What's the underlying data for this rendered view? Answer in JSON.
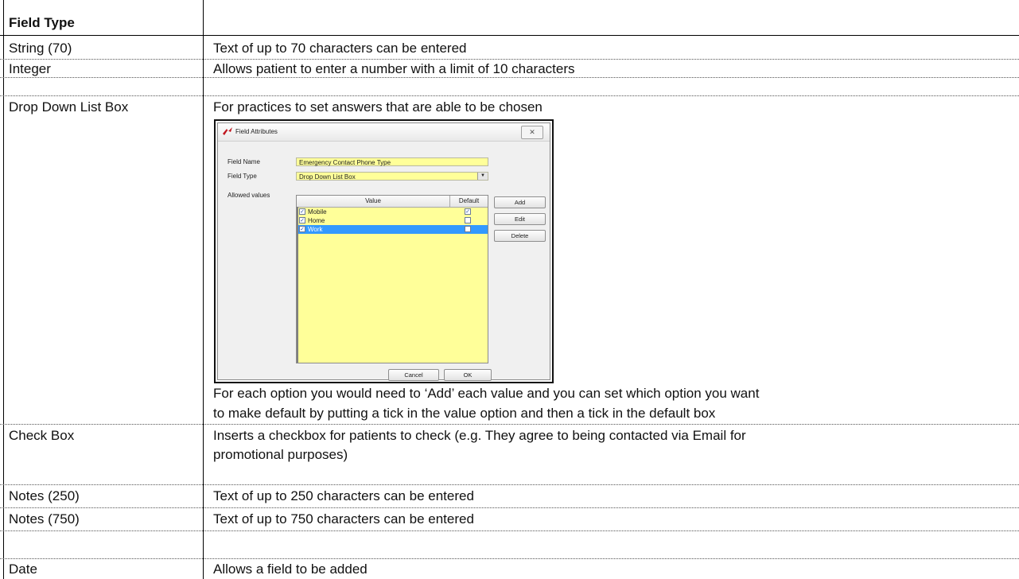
{
  "table": {
    "header": {
      "col1": "Field Type",
      "col2": ""
    },
    "rows": [
      {
        "type": "String (70)",
        "desc": "Text of up to 70 characters can be entered"
      },
      {
        "type": "Integer",
        "desc": "Allows patient to enter a number with a limit of 10 characters"
      },
      {
        "type": "Drop Down List Box",
        "desc": "For practices to set answers that are able to be chosen",
        "desc_after_line1": "For each option you would need to ‘Add’ each value and you can set which option you want",
        "desc_after_line2": "to make default by putting a tick in the value option and then a tick in the default box"
      },
      {
        "type": "Check Box",
        "desc_line1": "Inserts a checkbox for patients to check (e.g. They agree to being contacted via Email for",
        "desc_line2": "promotional purposes)"
      },
      {
        "type": "Notes (250)",
        "desc": "Text of up to 250 characters can be entered"
      },
      {
        "type": "Notes (750)",
        "desc": "Text of up to 750 characters can be entered"
      },
      {
        "type": "Date",
        "desc": "Allows a field to be added"
      }
    ]
  },
  "dialog": {
    "title": "Field Attributes",
    "close_glyph": "✕",
    "field_name_label": "Field Name",
    "field_name_value": "Emergency Contact Phone Type",
    "field_type_label": "Field Type",
    "field_type_value": "Drop Down List Box",
    "allowed_values_label": "Allowed values",
    "columns": {
      "value": "Value",
      "default": "Default"
    },
    "values": [
      {
        "label": "Mobile",
        "checked": true,
        "default": true,
        "selected": false
      },
      {
        "label": "Home",
        "checked": true,
        "default": false,
        "selected": false
      },
      {
        "label": "Work",
        "checked": true,
        "default": false,
        "selected": true
      }
    ],
    "buttons": {
      "add": "Add",
      "edit": "Edit",
      "delete": "Delete",
      "cancel": "Cancel",
      "ok": "OK"
    },
    "colors": {
      "field_bg": "#ffff99",
      "selection": "#3399ff"
    }
  }
}
